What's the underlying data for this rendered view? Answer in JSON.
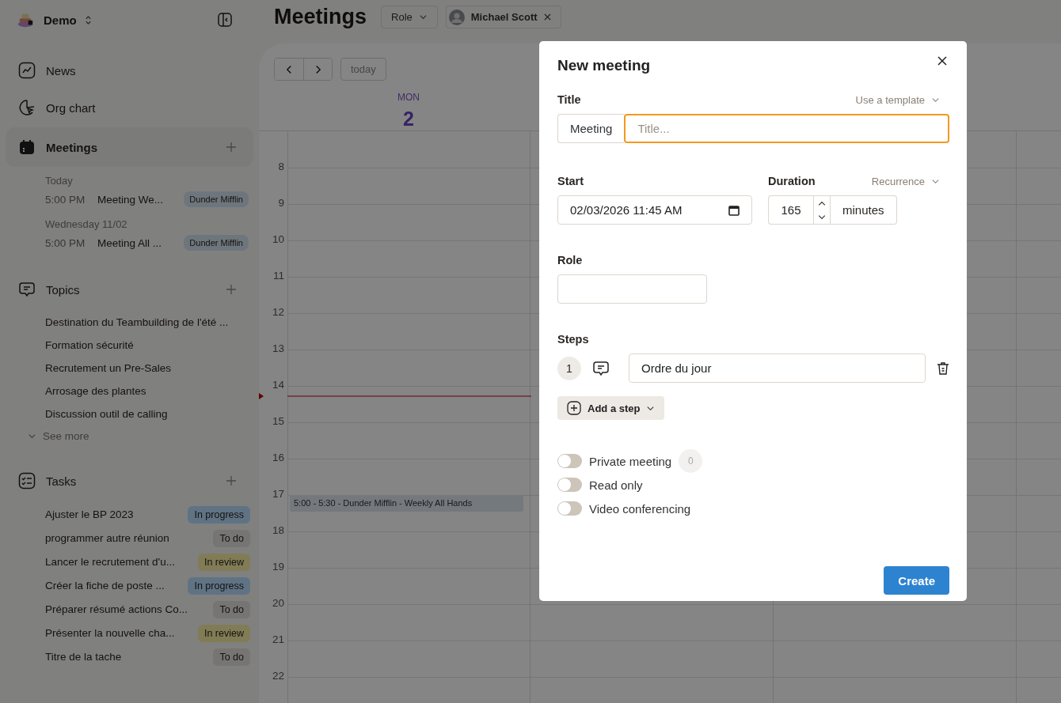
{
  "workspace": {
    "name": "Demo"
  },
  "nav": [
    {
      "label": "News",
      "selected": false
    },
    {
      "label": "Org chart",
      "selected": false
    },
    {
      "label": "Meetings",
      "selected": true
    }
  ],
  "meetings": [
    {
      "day": "Today",
      "items": [
        {
          "time": "5:00 PM",
          "title": "Meeting We...",
          "tag": "Dunder Mifflin"
        }
      ]
    },
    {
      "day": "Wednesday 11/02",
      "items": [
        {
          "time": "5:00 PM",
          "title": "Meeting All ...",
          "tag": "Dunder Mifflin"
        }
      ]
    }
  ],
  "topics": {
    "label": "Topics",
    "items": [
      "Destination du Teambuilding de l'été ...",
      "Formation sécurité",
      "Recrutement un Pre-Sales",
      "Arrosage des plantes",
      "Discussion outil de calling"
    ],
    "see_more": "See more"
  },
  "tasks": {
    "label": "Tasks",
    "items": [
      {
        "title": "Ajuster le BP 2023",
        "status": "In progress",
        "color": "#5f7384"
      },
      {
        "title": "programmer autre réunion",
        "status": "To do",
        "color": "#777573"
      },
      {
        "title": "Lancer le recrutement d'u...",
        "status": "In review",
        "color": "#817c56"
      },
      {
        "title": "Créer la fiche de poste ...",
        "status": "In progress",
        "color": "#5f7384"
      },
      {
        "title": "Préparer résumé actions Co...",
        "status": "To do",
        "color": "#777573"
      },
      {
        "title": "Présenter la nouvelle cha...",
        "status": "In review",
        "color": "#817c56"
      },
      {
        "title": "Titre de la tache",
        "status": "To do",
        "color": "#777573"
      }
    ]
  },
  "header": {
    "title": "Meetings",
    "role_filter": "Role",
    "person": "Michael Scott"
  },
  "calendar": {
    "today": "today",
    "weekday": "MON",
    "day": "2",
    "hours": [
      "8",
      "9",
      "10",
      "11",
      "12",
      "13",
      "14",
      "15",
      "16",
      "17",
      "18",
      "19",
      "20",
      "21",
      "22"
    ],
    "event": "5:00 - 5:30 - Dunder Mifflin - Weekly All Hands"
  },
  "modal": {
    "title": "New meeting",
    "title_label": "Title",
    "template": "Use a template",
    "prefix": "Meeting",
    "placeholder": "Title...",
    "start_label": "Start",
    "start_value": "02/03/2026 11:45 AM",
    "duration_label": "Duration",
    "recurrence": "Recurrence",
    "duration_value": "165",
    "duration_unit": "minutes",
    "role_label": "Role",
    "steps_label": "Steps",
    "steps": [
      {
        "number": "1",
        "value": "Ordre du jour"
      }
    ],
    "add_step": "Add a step",
    "toggles": [
      {
        "label": "Private meeting",
        "on": false,
        "count": "0"
      },
      {
        "label": "Read only",
        "on": false
      },
      {
        "label": "Video conferencing",
        "on": false
      }
    ],
    "create": "Create"
  }
}
